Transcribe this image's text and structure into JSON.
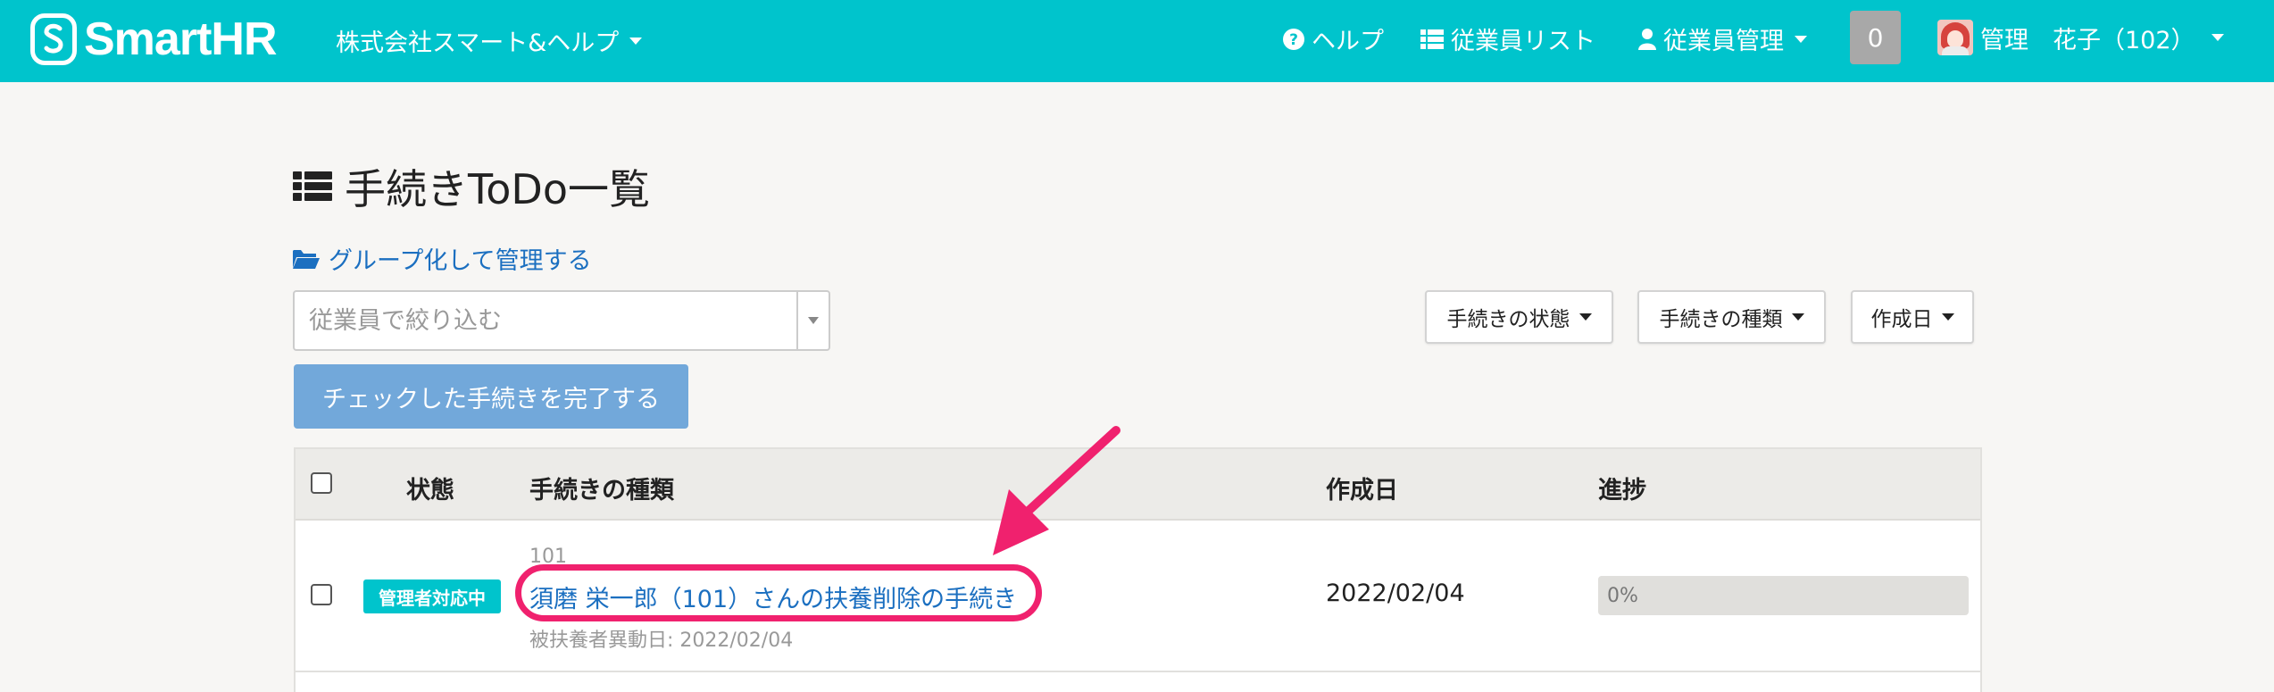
{
  "header": {
    "logo_text": "SmartHR",
    "company": "株式会社スマート&ヘルプ",
    "nav": {
      "help": "ヘルプ",
      "employee_list": "従業員リスト",
      "employee_manage": "従業員管理"
    },
    "notification_count": "0",
    "user_name": "管理　花子（102）"
  },
  "page": {
    "title": "手続きToDo一覧",
    "group_link": "グループ化して管理する",
    "filter_placeholder": "従業員で絞り込む",
    "filters": {
      "status": "手続きの状態",
      "type": "手続きの種類",
      "created": "作成日"
    },
    "complete_button": "チェックした手続きを完了する"
  },
  "table": {
    "headers": {
      "status": "状態",
      "type": "手続きの種類",
      "created": "作成日",
      "progress": "進捗"
    },
    "rows": [
      {
        "status": "管理者対応中",
        "employee_no": "101",
        "task": "須磨 栄一郎（101）さんの扶養削除の手続き",
        "meta": "被扶養者異動日: 2022/02/04",
        "created": "2022/02/04",
        "progress": "0%"
      }
    ]
  },
  "colors": {
    "brand": "#00c4cc",
    "link": "#1b6fc0",
    "annotation": "#f0216e",
    "button_disabled": "#72a8da"
  },
  "icons": [
    "smarthr-logo-icon",
    "question-circle-icon",
    "list-icon",
    "user-icon",
    "folder-open-icon",
    "caret-down-icon"
  ]
}
